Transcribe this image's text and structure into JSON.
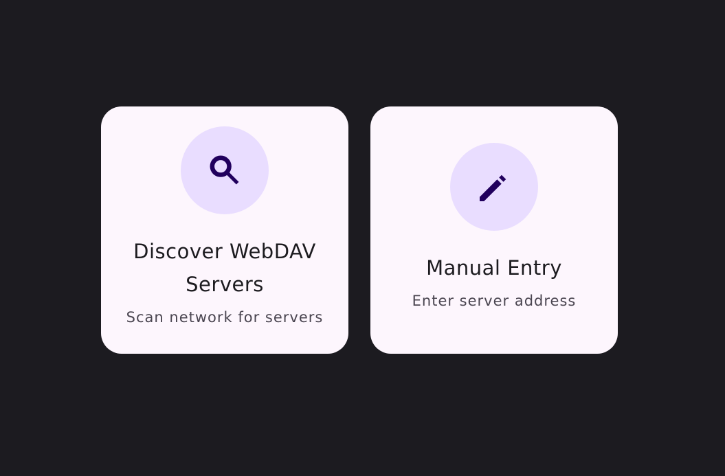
{
  "colors": {
    "background": "#1c1b20",
    "card_background": "#fdf6fd",
    "icon_circle": "#e9ddff",
    "icon_color": "#21005d"
  },
  "cards": [
    {
      "title": "Discover WebDAV Servers",
      "subtitle": "Scan network for servers",
      "icon": "search-icon"
    },
    {
      "title": "Manual Entry",
      "subtitle": "Enter server address",
      "icon": "edit-pencil-icon"
    }
  ]
}
